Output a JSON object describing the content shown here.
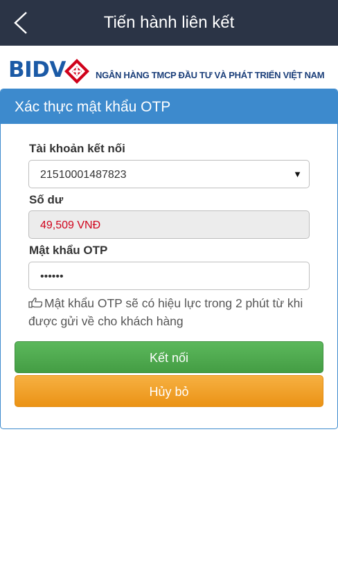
{
  "header": {
    "title": "Tiến hành liên kết",
    "back_icon": "chevron-left-icon"
  },
  "brand": {
    "logo_text": "BIDV",
    "bank_name": "NGÂN HÀNG TMCP ĐẦU TƯ VÀ PHÁT TRIỂN VIỆT NAM",
    "logo_colors": [
      "#1b5aa6",
      "#d0021b"
    ]
  },
  "panel": {
    "title": "Xác thực mật khẩu OTP",
    "account": {
      "label": "Tài khoản kết nối",
      "value": "21510001487823"
    },
    "balance": {
      "label": "Số dư",
      "value": "49,509 VNĐ"
    },
    "otp": {
      "label": "Mật khẩu OTP",
      "value": "••••••"
    },
    "note": "Mật khẩu OTP sẽ có hiệu lực trong 2 phút từ khi được gửi về cho khách hàng",
    "connect_button": "Kết nối",
    "cancel_button": "Hủy bỏ"
  },
  "colors": {
    "header_bg": "#2b3446",
    "panel_accent": "#3d8acd",
    "connect": "#4cae4c",
    "cancel": "#f0a030",
    "balance_text": "#d0021b"
  }
}
